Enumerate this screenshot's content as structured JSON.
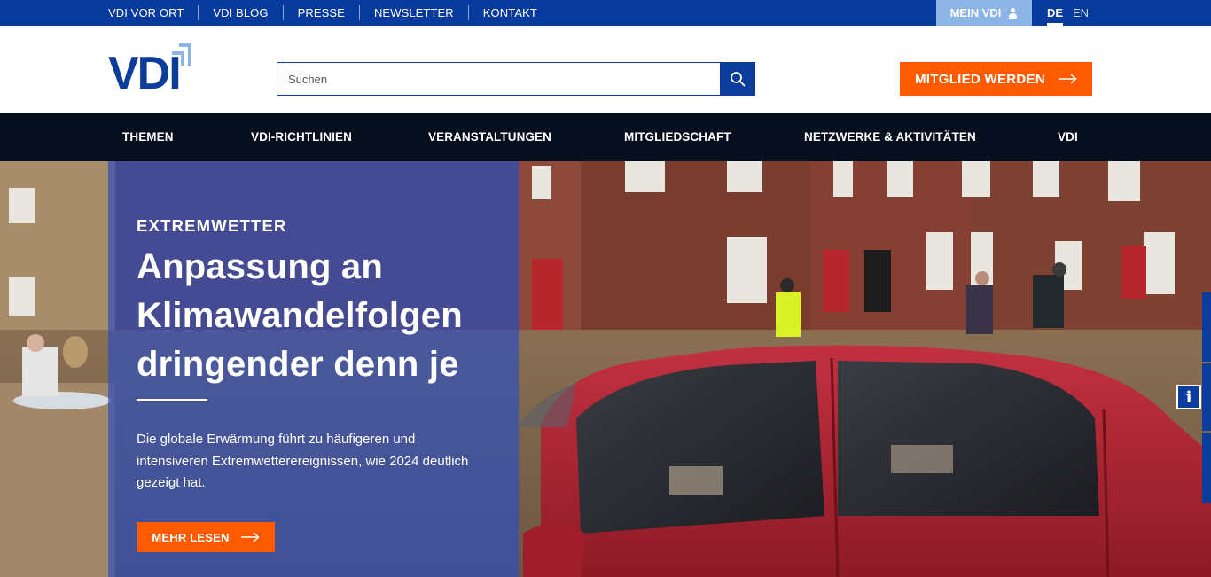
{
  "topbar": {
    "links": [
      "VDI VOR ORT",
      "VDI BLOG",
      "PRESSE",
      "NEWSLETTER",
      "KONTAKT"
    ],
    "account_label": "MEIN VDI",
    "languages": {
      "active": "DE",
      "other": "EN"
    }
  },
  "header": {
    "logo_text": "VDI",
    "search_placeholder": "Suchen",
    "cta_label": "MITGLIED WERDEN"
  },
  "mainnav": {
    "items": [
      "THEMEN",
      "VDI-RICHTLINIEN",
      "VERANSTALTUNGEN",
      "MITGLIEDSCHAFT",
      "NETZWERKE & AKTIVITÄTEN",
      "VDI"
    ]
  },
  "hero": {
    "kicker": "EXTREMWETTER",
    "headline": "Anpassung an Klimawandelfolgen dringender denn je",
    "teaser": "Die globale Erwärmung führt zu häufigeren und intensiveren Extremwetterereignissen, wie 2024 deutlich gezeigt hat.",
    "button_label": "MEHR LESEN"
  },
  "colors": {
    "brand_blue": "#063a9c",
    "accent_orange": "#ff5a00",
    "nav_dark": "#060f1e"
  },
  "icons": [
    "user-icon",
    "search-icon",
    "arrow-right-icon",
    "info-icon"
  ]
}
